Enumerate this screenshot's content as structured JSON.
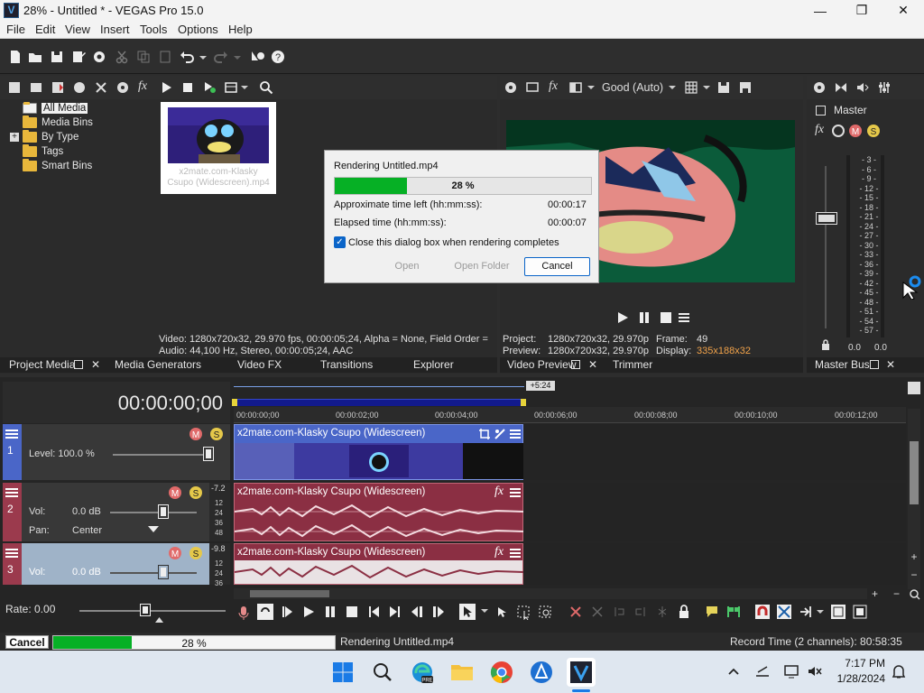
{
  "window": {
    "title": "28% - Untitled * - VEGAS Pro 15.0",
    "app_icon": "V",
    "minimize": "—",
    "maximize": "❐",
    "close": "✕"
  },
  "menu": [
    "File",
    "Edit",
    "View",
    "Insert",
    "Tools",
    "Options",
    "Help"
  ],
  "project_media": {
    "tree": [
      "All Media",
      "Media Bins",
      "By Type",
      "Tags",
      "Smart Bins"
    ],
    "expand_glyph": "+",
    "thumb_caption_line1": "x2mate.com-Klasky",
    "thumb_caption_line2": "Csupo (Widescreen).mp4",
    "info_line1": "Video: 1280x720x32, 29.970 fps, 00:00:05;24, Alpha = None, Field Order =",
    "info_line2": "Audio: 44,100 Hz, Stereo, 00:00:05;24, AAC"
  },
  "tabs_left": [
    "Project Media",
    "Media Generators",
    "Video FX",
    "Transitions",
    "Explorer"
  ],
  "preview": {
    "quality": "Good (Auto)",
    "project_label": "Project:",
    "project_value": "1280x720x32, 29.970p",
    "preview_label": "Preview:",
    "preview_value": "1280x720x32, 29.970p",
    "frame_label": "Frame:",
    "frame_value": "49",
    "display_label": "Display:",
    "display_value": "335x188x32",
    "tabs": [
      "Video Preview",
      "Trimmer"
    ]
  },
  "master": {
    "label": "Master",
    "meter_ticks": [
      "3",
      "6",
      "9",
      "12",
      "15",
      "18",
      "21",
      "24",
      "27",
      "30",
      "33",
      "36",
      "39",
      "42",
      "45",
      "48",
      "51",
      "54",
      "57"
    ],
    "left_value": "0.0",
    "right_value": "0.0",
    "tab": "Master Bus"
  },
  "render_dialog": {
    "title": "Rendering Untitled.mp4",
    "progress_text": "28 %",
    "progress": 0.28,
    "time_left_label": "Approximate time left (hh:mm:ss):",
    "time_left_value": "00:00:17",
    "elapsed_label": "Elapsed time (hh:mm:ss):",
    "elapsed_value": "00:00:07",
    "checkbox_label": "Close this dialog box when rendering completes",
    "checkbox_checked": true,
    "open": "Open",
    "open_folder": "Open Folder",
    "cancel": "Cancel"
  },
  "timeline": {
    "timecode": "00:00:00;00",
    "loop_end": "+5:24",
    "ruler": [
      "00:00:00;00",
      "00:00:02;00",
      "00:00:04;00",
      "00:00:06;00",
      "00:00:08;00",
      "00:00:10;00",
      "00:00:12;00"
    ],
    "track1": {
      "number": "1",
      "level_label": "Level: 100.0 %",
      "clip": "x2mate.com-Klasky Csupo (Widescreen)"
    },
    "track2": {
      "number": "2",
      "vol_label": "Vol:",
      "vol_value": "0.0 dB",
      "pan_label": "Pan:",
      "pan_value": "Center",
      "peak": "-7.2",
      "scale": [
        "12",
        "24",
        "36",
        "48"
      ],
      "clip": "x2mate.com-Klasky Csupo (Widescreen)"
    },
    "track3": {
      "number": "3",
      "vol_label": "Vol:",
      "vol_value": "0.0 dB",
      "peak": "-9.8",
      "scale": [
        "12",
        "24",
        "36"
      ],
      "clip": "x2mate.com-Klasky Csupo (Widescreen)"
    },
    "rate": "Rate: 0.00"
  },
  "status": {
    "cancel": "Cancel",
    "progress_text": "28 %",
    "progress": 0.28,
    "message": "Rendering Untitled.mp4",
    "record_time": "Record Time (2 channels): 80:58:35"
  },
  "taskbar": {
    "time": "7:17 PM",
    "date": "1/28/2024"
  },
  "colors": {
    "accent_green": "#18b72f",
    "video_track": "#4a66c8",
    "audio_track": "#9b3a4d",
    "audio_track_selected": "#9fb3c8"
  }
}
